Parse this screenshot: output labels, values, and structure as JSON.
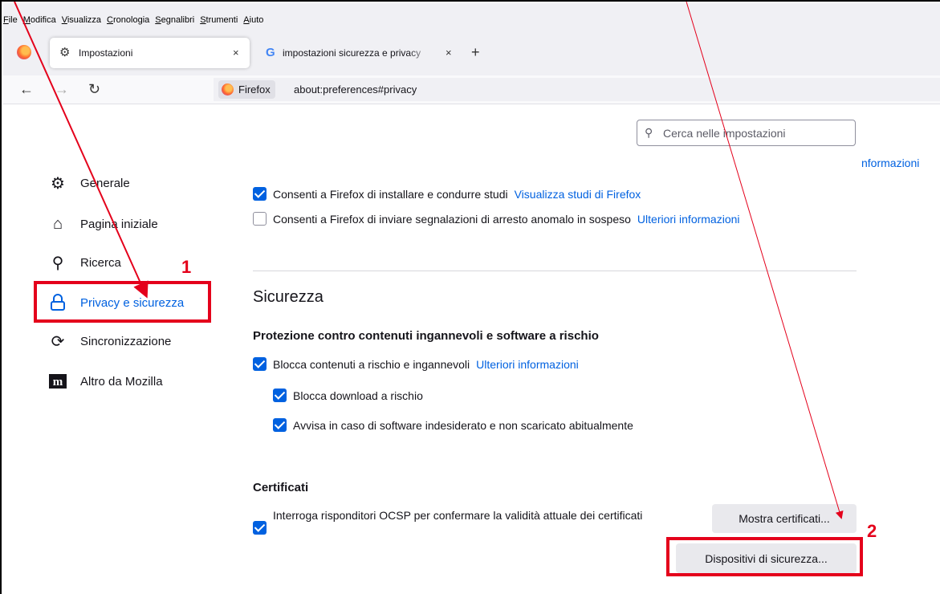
{
  "menubar": {
    "items": [
      "File",
      "Modifica",
      "Visualizza",
      "Cronologia",
      "Segnalibri",
      "Strumenti",
      "Aiuto"
    ]
  },
  "tabs": {
    "active": {
      "title": "Impostazioni",
      "icon": "gear-icon"
    },
    "second": {
      "title": "impostazioni sicurezza e privacy",
      "icon": "google-icon"
    },
    "close_glyph": "×",
    "new_tab_glyph": "+"
  },
  "navbar": {
    "identity_label": "Firefox",
    "url": "about:preferences#privacy"
  },
  "search": {
    "placeholder": "Cerca nelle impostazioni"
  },
  "top_link": "nformazioni",
  "sidebar": {
    "items": [
      {
        "label": "Generale",
        "icon": "gear-icon"
      },
      {
        "label": "Pagina iniziale",
        "icon": "home-icon"
      },
      {
        "label": "Ricerca",
        "icon": "search-icon"
      },
      {
        "label": "Privacy e sicurezza",
        "icon": "lock-icon",
        "selected": true
      },
      {
        "label": "Sincronizzazione",
        "icon": "sync-icon"
      },
      {
        "label": "Altro da Mozilla",
        "icon": "mozilla-icon"
      }
    ]
  },
  "data_collection": {
    "studies": {
      "label": "Consenti a Firefox di installare e condurre studi",
      "link": "Visualizza studi di Firefox",
      "checked": true
    },
    "crash": {
      "label": "Consenti a Firefox di inviare segnalazioni di arresto anomalo in sospeso",
      "link": "Ulteriori informazioni",
      "checked": false
    }
  },
  "security": {
    "title": "Sicurezza",
    "protection_heading": "Protezione contro contenuti ingannevoli e software a rischio",
    "block_dangerous": {
      "label": "Blocca contenuti a rischio e ingannevoli",
      "link": "Ulteriori informazioni",
      "checked": true
    },
    "block_downloads": {
      "label": "Blocca download a rischio",
      "checked": true
    },
    "warn_software": {
      "label": "Avvisa in caso di software indesiderato e non scaricato abitualmente",
      "checked": true
    },
    "certs_heading": "Certificati",
    "ocsp": {
      "label": "Interroga risponditori OCSP per confermare la validità attuale dei certificati",
      "checked": true
    },
    "show_certs_button": "Mostra certificati...",
    "security_devices_button": "Dispositivi di sicurezza..."
  },
  "annotations": {
    "step1": "1",
    "step2": "2",
    "color": "#e4001b"
  }
}
